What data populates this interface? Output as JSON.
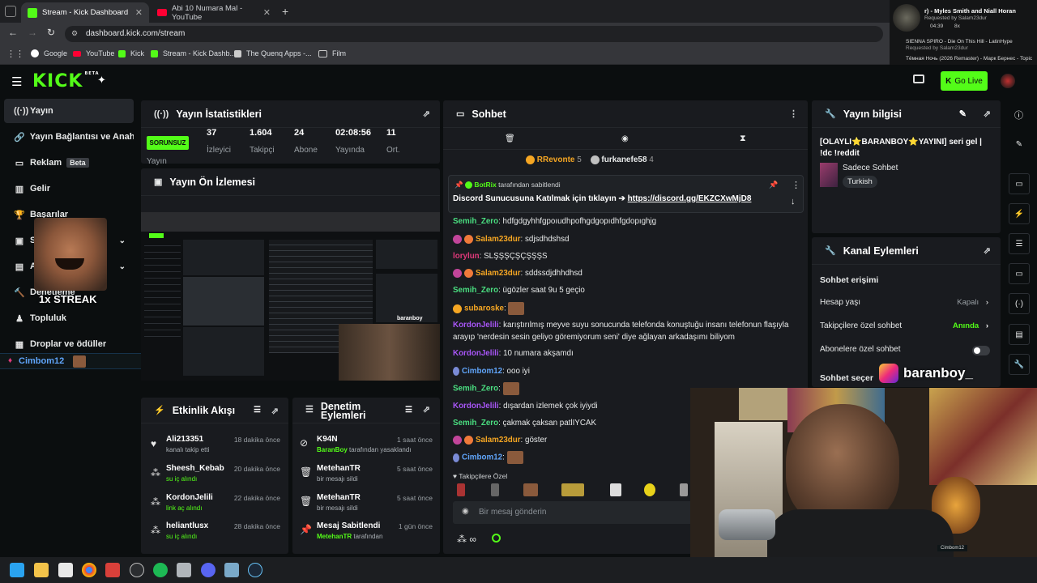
{
  "browser": {
    "tabs": [
      {
        "label": "Stream - Kick Dashboard",
        "active": true
      },
      {
        "label": "Abi 10 Numara Mal - YouTube",
        "active": false
      }
    ],
    "url": "dashboard.kick.com/stream",
    "bookmarks": [
      "Google",
      "YouTube",
      "Kick",
      "Stream - Kick Dashb...",
      "The Quenq Apps -...",
      "Film"
    ]
  },
  "music": {
    "now_playing": "r) - Myles Smith and Niall Horan",
    "requested_by": "Requested by Salam23dur",
    "time": "04:39",
    "queue_count": "8x",
    "queue": [
      {
        "title": "SIENNA SPIRO - Die On This Hill - LatinHype",
        "by": "Requested by Salam23dur"
      },
      {
        "title": "Тёмная Ночь (2026 Remaster) - Марк Бернес - Topic",
        "by": ""
      }
    ]
  },
  "header": {
    "logo": "KICK",
    "logo_badge": "BETA",
    "go_live": "Go Live"
  },
  "sidebar": {
    "items": [
      {
        "label": "Yayın",
        "active": true
      },
      {
        "label": "Yayın Bağlantısı ve Anahtarı"
      },
      {
        "label": "Reklam",
        "badge": "Beta"
      },
      {
        "label": "Gelir"
      },
      {
        "label": "Başarılar"
      },
      {
        "label": "S"
      },
      {
        "label": "A"
      },
      {
        "label": "Denetleme"
      },
      {
        "label": "Topluluk"
      },
      {
        "label": "Droplar ve ödüller"
      }
    ],
    "streak_label": "1x STREAK",
    "viewer_chip": "Cimbom12"
  },
  "stats": {
    "title": "Yayın İstatistikleri",
    "status": "SORUNSUZ",
    "status_label": "Yayın",
    "items": [
      {
        "value": "37",
        "label": "İzleyici"
      },
      {
        "value": "1.604",
        "label": "Takipçi"
      },
      {
        "value": "24",
        "label": "Abone"
      },
      {
        "value": "02:08:56",
        "label": "Yayında"
      },
      {
        "value": "11",
        "label": "Ort."
      }
    ]
  },
  "preview": {
    "title": "Yayın Ön İzlemesi",
    "overlay_name": "baranboy"
  },
  "activity": {
    "title": "Etkinlik Akışı",
    "items": [
      {
        "name": "Ali213351",
        "sub": "kanalı takip etti",
        "time": "18 dakika önce",
        "icon": "heart-icon"
      },
      {
        "name": "Sheesh_Kebab",
        "sub": "su iç alındı",
        "time": "20 dakika önce",
        "icon": "points-icon"
      },
      {
        "name": "KordonJelili",
        "sub": "link aç alındı",
        "time": "22 dakika önce",
        "icon": "points-icon"
      },
      {
        "name": "heliantlusx",
        "sub": "su iç alındı",
        "time": "28 dakika önce",
        "icon": "points-icon"
      }
    ]
  },
  "moderation": {
    "title_line1": "Denetim",
    "title_line2": "Eylemleri",
    "items": [
      {
        "name": "K94N",
        "sub_user": "BaranBoy",
        "sub": "tarafından yasaklandı",
        "time": "1 saat önce",
        "icon": "ban-icon"
      },
      {
        "name": "MetehanTR",
        "sub_user": "",
        "sub": "bir mesajı sildi",
        "time": "5 saat önce",
        "icon": "trash-icon"
      },
      {
        "name": "MetehanTR",
        "sub_user": "",
        "sub": "bir mesajı sildi",
        "time": "5 saat önce",
        "icon": "trash-icon"
      },
      {
        "name": "Mesaj Sabitlendi",
        "sub_user": "MetehanTR",
        "sub": "tarafından",
        "time": "1 gün önce",
        "icon": "pin-icon"
      }
    ]
  },
  "chat": {
    "title": "Sohbet",
    "gifters": [
      {
        "name": "RRevonte",
        "count": "5"
      },
      {
        "name": "furkanefe58",
        "count": "4"
      }
    ],
    "pinned": {
      "by_user": "BotRix",
      "by_text": "tarafından sabitlendi",
      "text": "Discord Sunucusuna Katılmak için tıklayın ➔",
      "link": "https://discord.gg/EKZCXwMjD8"
    },
    "messages": [
      {
        "user": "Semih_Zero",
        "color": "#4ade80",
        "text": "hdfgdgyhhfgpoıudhpofhgdgopıdhfgdopıghjg"
      },
      {
        "user": "Salam23dur",
        "color": "#f5a623",
        "text": "sdjsdhdshsd",
        "badges": true
      },
      {
        "user": "lorylun",
        "color": "#e0397a",
        "text": "SLŞŞŞÇŞÇŞŞŞS"
      },
      {
        "user": "Salam23dur",
        "color": "#f5a623",
        "text": "sddssdjdhhdhsd",
        "badges": true
      },
      {
        "user": "Semih_Zero",
        "color": "#4ade80",
        "text": "ügözler saat 9u 5 geçio"
      },
      {
        "user": "subaroske",
        "color": "#f5a623",
        "text": "",
        "emote": true
      },
      {
        "user": "KordonJelili",
        "color": "#a855f7",
        "text": "karıştırılmış meyve suyu sonucunda telefonda konuştuğu insanı telefonun flaşıyla arayıp 'nerdesin sesin geliyo göremiyorum seni' diye ağlayan arkadaşımı biliyom"
      },
      {
        "user": "KordonJelili",
        "color": "#a855f7",
        "text": "10 numara akşamdı"
      },
      {
        "user": "Cimbom12",
        "color": "#60a5fa",
        "text": "ooo iyi"
      },
      {
        "user": "Semih_Zero",
        "color": "#4ade80",
        "text": "",
        "emote": true
      },
      {
        "user": "KordonJelili",
        "color": "#a855f7",
        "text": "dışardan izlemek çok iyiydi"
      },
      {
        "user": "Semih_Zero",
        "color": "#4ade80",
        "text": "çakmak çaksan patlIYCAK"
      },
      {
        "user": "Salam23dur",
        "color": "#f5a623",
        "text": "göster",
        "badges": true
      },
      {
        "user": "Cimbom12",
        "color": "#60a5fa",
        "text": "",
        "emote": true
      }
    ],
    "followers_only": "Takipçilere Özel",
    "input_placeholder": "Bir mesaj gönderin"
  },
  "info": {
    "title": "Yayın bilgisi",
    "stream_title": "[OLAYLI⭐BARANBOY⭐YAYINI] seri gel | !dc !reddit",
    "category": "Sadece Sohbet",
    "language": "Turkish"
  },
  "channel": {
    "title": "Kanal Eylemleri",
    "section": "Sohbet erişimi",
    "rows": [
      {
        "label": "Hesap yaşı",
        "value": "Kapalı"
      },
      {
        "label": "Takipçilere özel sohbet",
        "value": "Anında"
      },
      {
        "label": "Abonelere özel sohbet",
        "value": ""
      }
    ],
    "slow_mode_label": "Sohbet seçer"
  },
  "overlay": {
    "handle": "baranboy_",
    "cam_chip": "Cimbom12"
  }
}
